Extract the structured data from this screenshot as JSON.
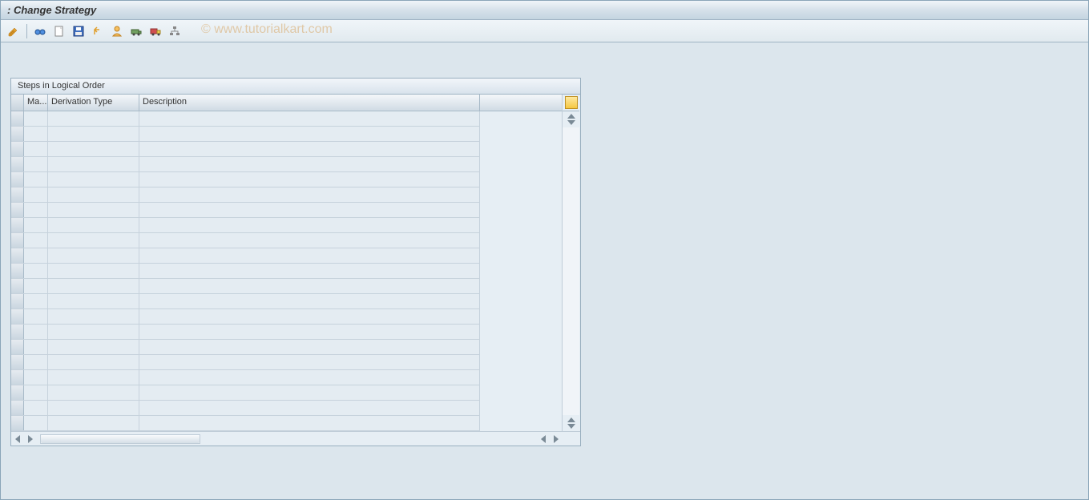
{
  "window": {
    "title": ": Change Strategy"
  },
  "watermark": "© www.tutorialkart.com",
  "toolbar_icons": {
    "pencil": "pencil-icon",
    "glasses": "display-icon",
    "create": "create-icon",
    "save": "save-icon",
    "back": "back-icon",
    "person": "person-icon",
    "transport1": "transport-a-icon",
    "truck": "truck-icon",
    "hierarchy": "hierarchy-icon"
  },
  "panel": {
    "title": "Steps in Logical Order",
    "columns": {
      "selector": "",
      "ma": "Ma...",
      "derivation_type": "Derivation Type",
      "description": "Description"
    },
    "rows": [
      {
        "ma": "",
        "dt": "",
        "desc": ""
      },
      {
        "ma": "",
        "dt": "",
        "desc": ""
      },
      {
        "ma": "",
        "dt": "",
        "desc": ""
      },
      {
        "ma": "",
        "dt": "",
        "desc": ""
      },
      {
        "ma": "",
        "dt": "",
        "desc": ""
      },
      {
        "ma": "",
        "dt": "",
        "desc": ""
      },
      {
        "ma": "",
        "dt": "",
        "desc": ""
      },
      {
        "ma": "",
        "dt": "",
        "desc": ""
      },
      {
        "ma": "",
        "dt": "",
        "desc": ""
      },
      {
        "ma": "",
        "dt": "",
        "desc": ""
      },
      {
        "ma": "",
        "dt": "",
        "desc": ""
      },
      {
        "ma": "",
        "dt": "",
        "desc": ""
      },
      {
        "ma": "",
        "dt": "",
        "desc": ""
      },
      {
        "ma": "",
        "dt": "",
        "desc": ""
      },
      {
        "ma": "",
        "dt": "",
        "desc": ""
      },
      {
        "ma": "",
        "dt": "",
        "desc": ""
      },
      {
        "ma": "",
        "dt": "",
        "desc": ""
      },
      {
        "ma": "",
        "dt": "",
        "desc": ""
      },
      {
        "ma": "",
        "dt": "",
        "desc": ""
      },
      {
        "ma": "",
        "dt": "",
        "desc": ""
      },
      {
        "ma": "",
        "dt": "",
        "desc": ""
      }
    ]
  }
}
